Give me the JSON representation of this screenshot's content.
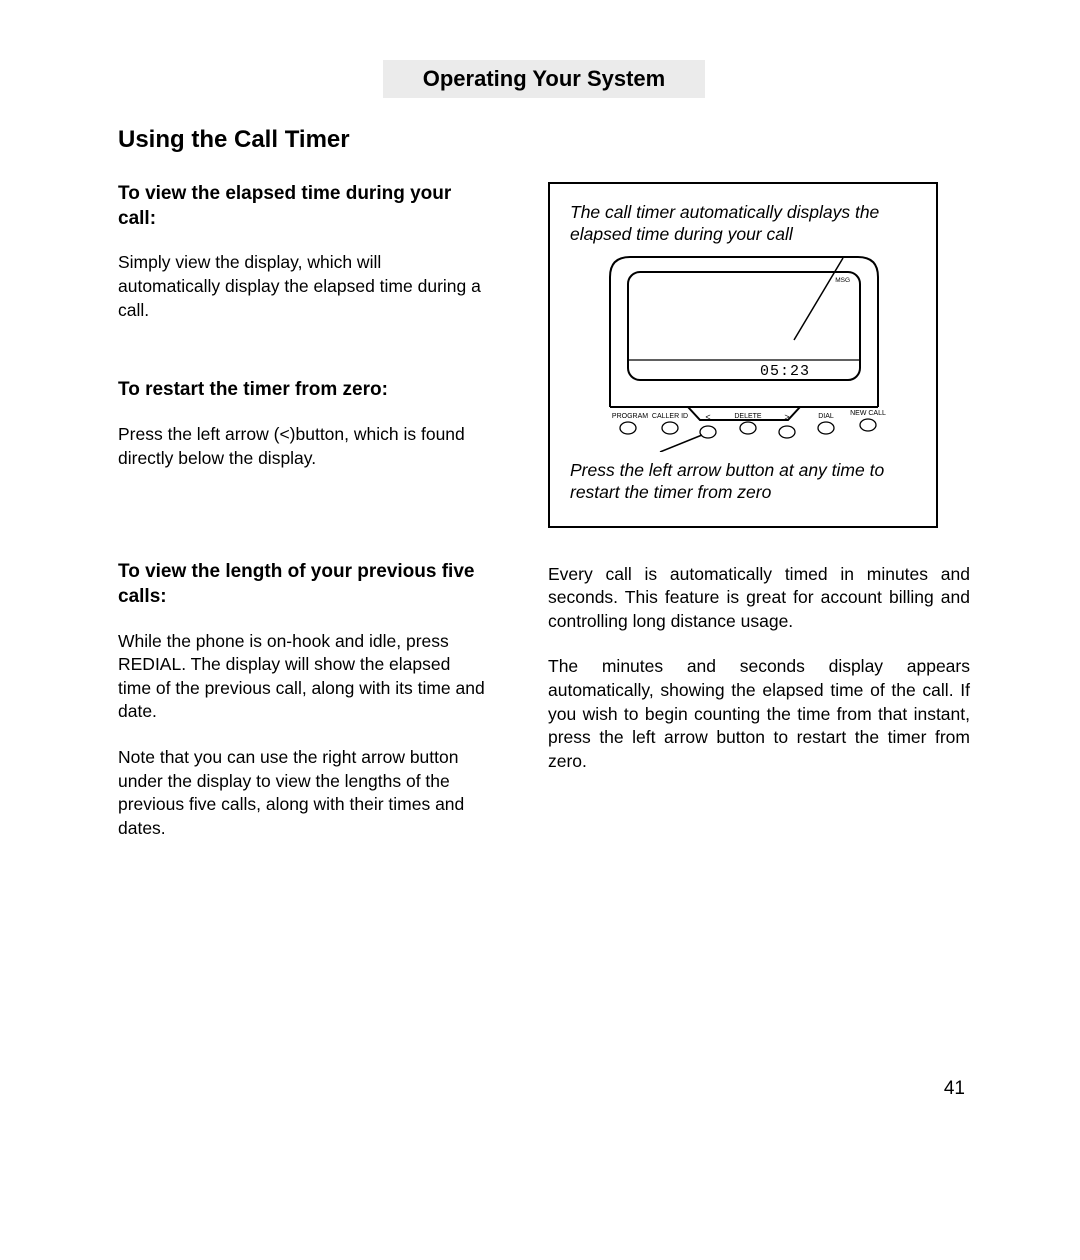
{
  "banner": "Operating Your System",
  "section_title": "Using the Call Timer",
  "left": {
    "h1": "To view the elapsed time during your call:",
    "p1": "Simply view the display, which will automatically display the elapsed time during a call.",
    "h2": "To restart the timer from zero:",
    "p2": "Press the left arrow (<)button, which is found directly below the display.",
    "h3": "To view the length of your previous five calls:",
    "p3": "While the phone is on-hook and idle, press REDIAL.  The display will show the elapsed time of the previous call, along with its time and date.",
    "p4": "Note that you can use the right arrow button under the display to view the lengths of the previous five calls, along with their times and dates."
  },
  "right": {
    "caption_top": "The call timer automatically displays the elapsed time during your call",
    "caption_bottom": "Press the left arrow button at any time to restart the timer from zero",
    "p1": "Every call is automatically timed in minutes and seconds.  This feature is great for account billing and controlling long distance usage.",
    "p2": "The minutes and seconds display appears automatically, showing the elapsed time of the call.  If you wish to begin counting the time from that instant, press the left arrow button to restart the timer from zero."
  },
  "device": {
    "timer_value": "05:23",
    "msg_label": "MSG",
    "buttons": [
      {
        "label": "PROGRAM"
      },
      {
        "label": "CALLER ID"
      },
      {
        "label": "<"
      },
      {
        "label": "DELETE"
      },
      {
        "label": ">"
      },
      {
        "label": "DIAL"
      },
      {
        "label": "NEW CALL"
      }
    ]
  },
  "page_number": "41"
}
